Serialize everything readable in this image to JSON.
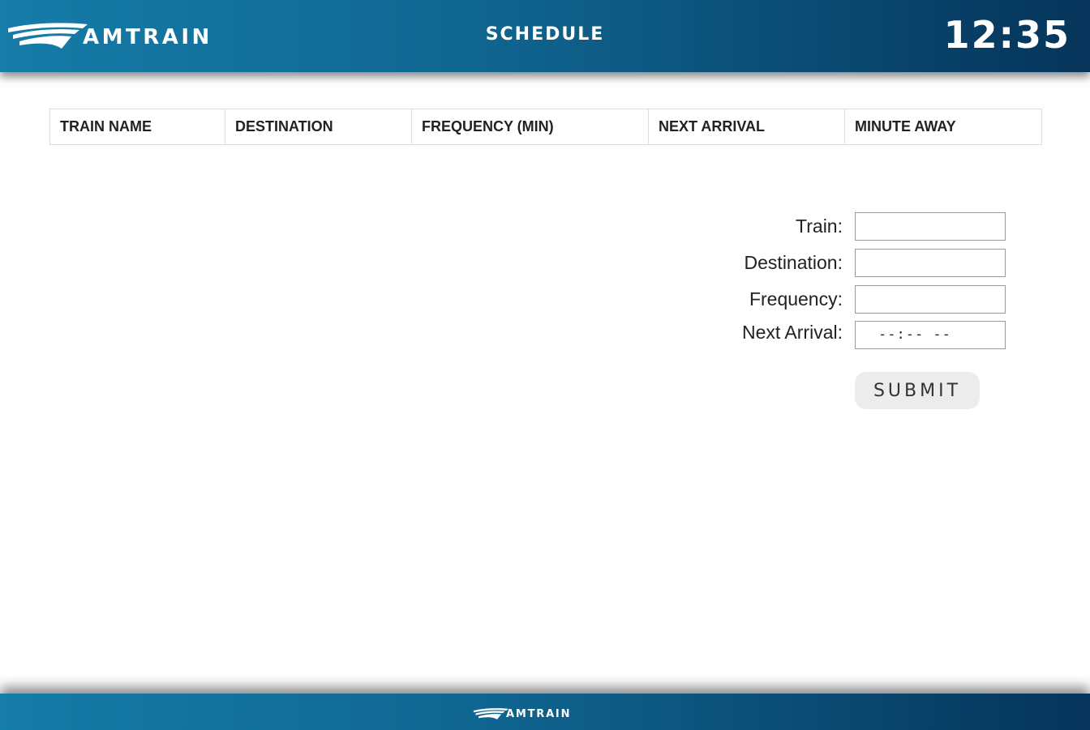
{
  "header": {
    "logo_text": "AMTRAIN",
    "title": "SCHEDULE",
    "clock": "12:35"
  },
  "table": {
    "columns": [
      "TRAIN NAME",
      "DESTINATION",
      "FREQUENCY (MIN)",
      "NEXT ARRIVAL",
      "MINUTE AWAY"
    ],
    "rows": []
  },
  "form": {
    "train_label": "Train:",
    "train_value": "",
    "destination_label": "Destination:",
    "destination_value": "",
    "frequency_label": "Frequency:",
    "frequency_value": "",
    "next_arrival_label": "Next Arrival:",
    "next_arrival_display": "--:-- --",
    "submit_label": "SUBMIT"
  },
  "footer": {
    "logo_text": "AMTRAIN"
  },
  "colors": {
    "header_start": "#167ca8",
    "header_end": "#06345a",
    "text": "#222222",
    "button_bg": "#ececec"
  },
  "icons": {
    "logo": "amtrain-swoosh-logo"
  }
}
